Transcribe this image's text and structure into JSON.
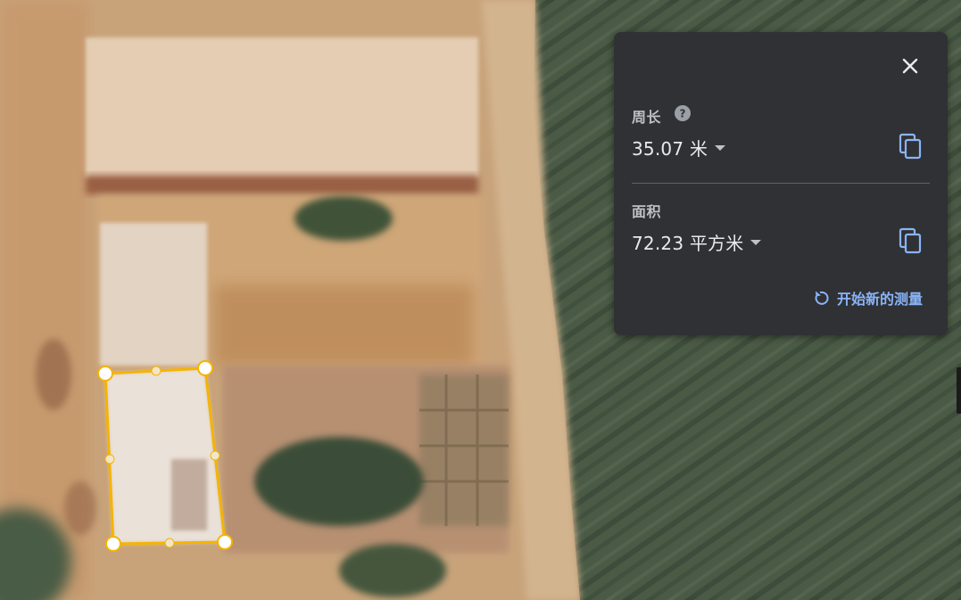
{
  "measure_panel": {
    "perimeter_label": "周长",
    "perimeter_value": "35.07 米",
    "area_label": "面积",
    "area_value": "72.23 平方米",
    "new_measurement_label": "开始新的测量"
  },
  "icons": {
    "close": "close-icon",
    "help": "help-icon",
    "unit_dropdown": "chevron-down-icon",
    "copy": "copy-icon",
    "restart": "restart-icon"
  },
  "colors": {
    "panel_background": "#303134",
    "accent": "#8ab4f8",
    "measurement_outline": "#f4b400"
  }
}
